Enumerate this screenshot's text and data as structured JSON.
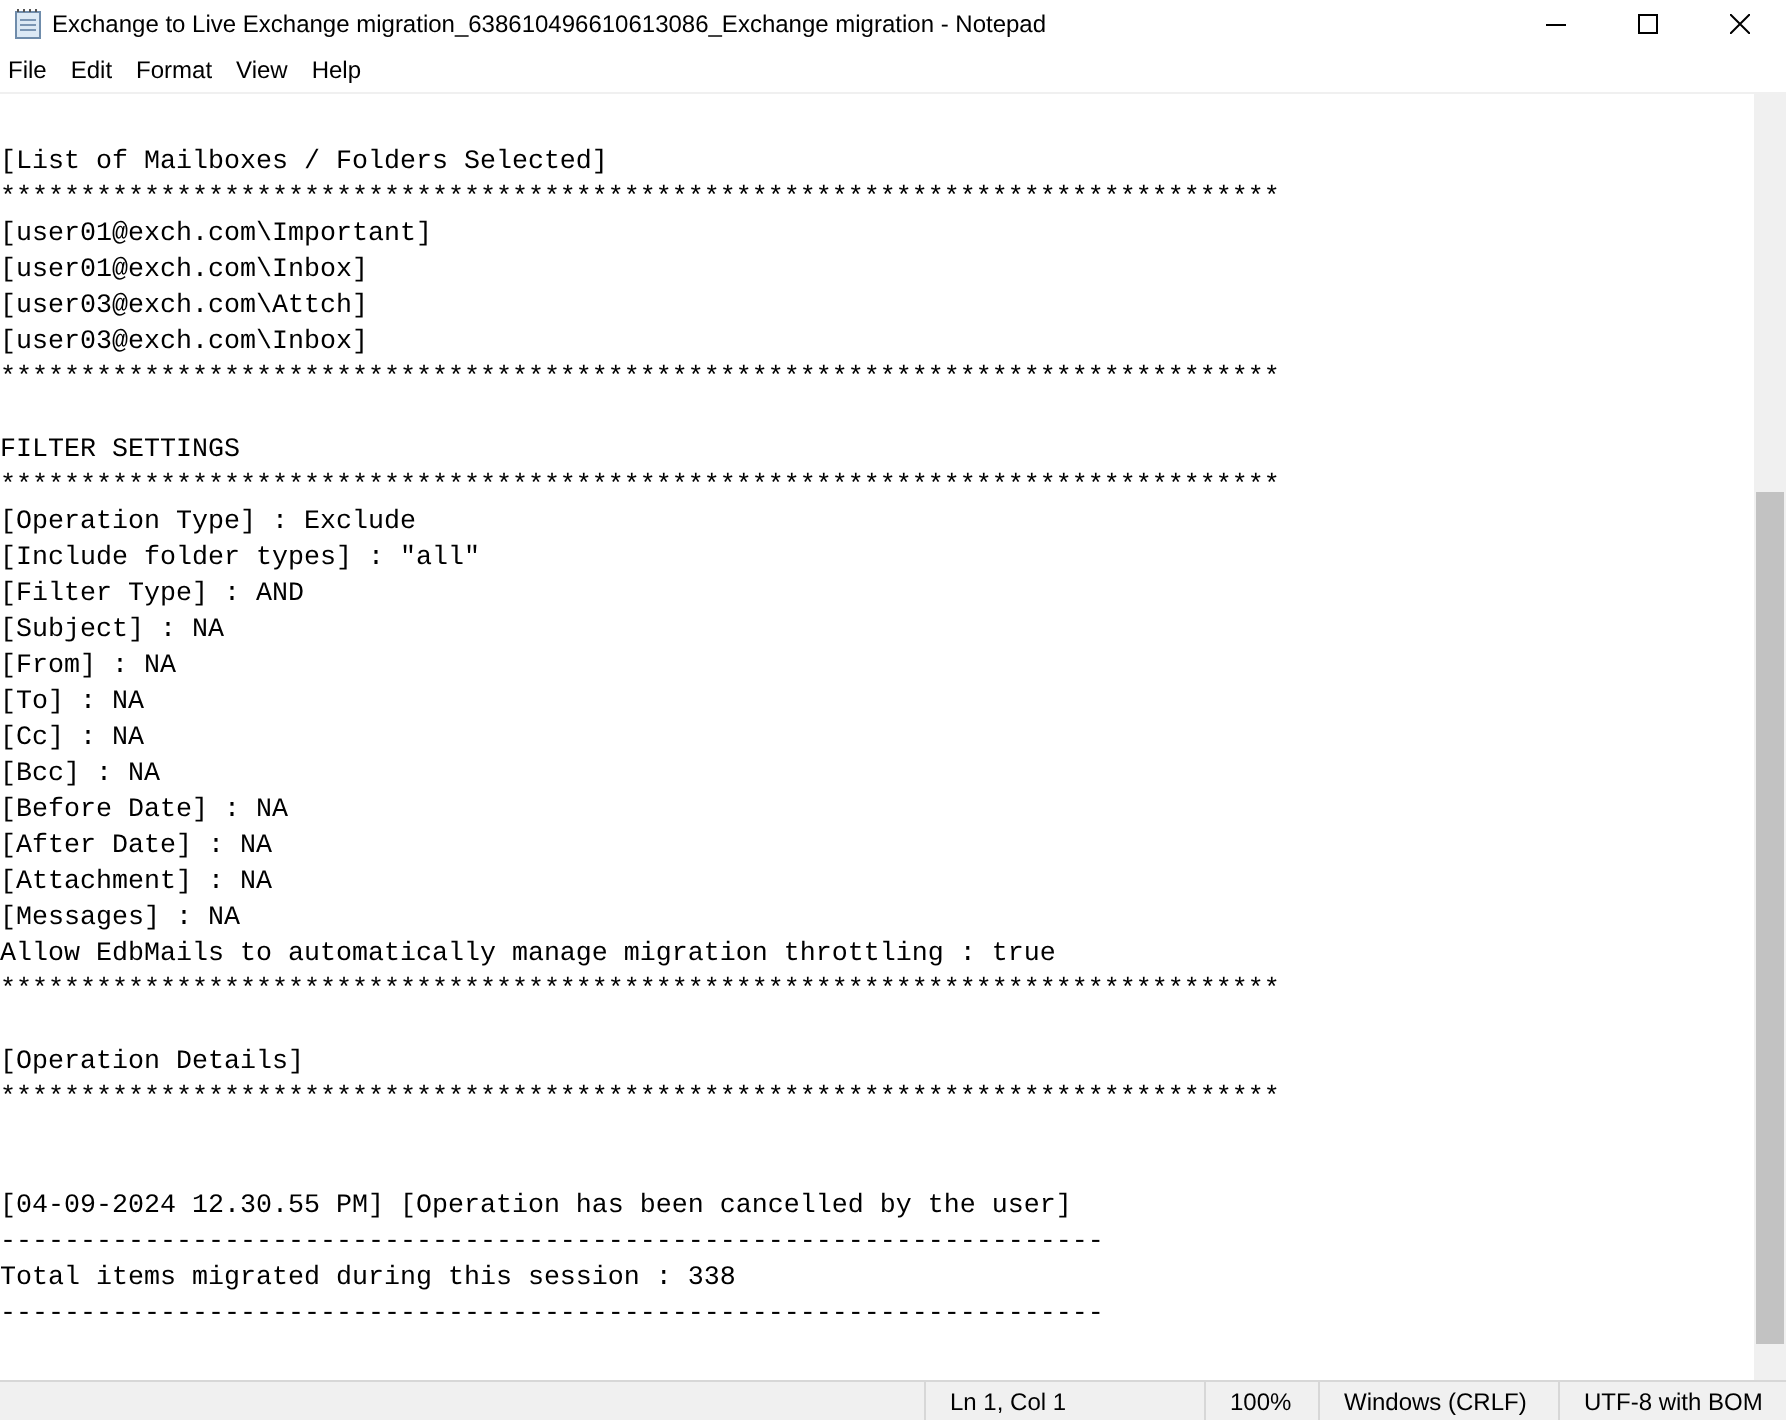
{
  "window": {
    "title": "Exchange to Live Exchange migration_638610496610613086_Exchange migration - Notepad"
  },
  "menu": [
    "File",
    "Edit",
    "Format",
    "View",
    "Help"
  ],
  "lines": [
    {
      "kind": "blank"
    },
    {
      "kind": "text",
      "text": "[List of Mailboxes / Folders Selected]"
    },
    {
      "kind": "text",
      "text": "********************************************************************************"
    },
    {
      "kind": "text",
      "text": "[user01@exch.com\\Important]"
    },
    {
      "kind": "text",
      "text": "[user01@exch.com\\Inbox]"
    },
    {
      "kind": "text",
      "text": "[user03@exch.com\\Attch]"
    },
    {
      "kind": "text",
      "text": "[user03@exch.com\\Inbox]"
    },
    {
      "kind": "text",
      "text": "********************************************************************************"
    },
    {
      "kind": "blank"
    },
    {
      "kind": "text",
      "text": "FILTER SETTINGS"
    },
    {
      "kind": "text",
      "text": "********************************************************************************"
    },
    {
      "kind": "text",
      "text": "[Operation Type] : Exclude"
    },
    {
      "kind": "text",
      "text": "[Include folder types] : \"all\""
    },
    {
      "kind": "text",
      "text": "[Filter Type] : AND"
    },
    {
      "kind": "text",
      "text": "[Subject] : NA"
    },
    {
      "kind": "text",
      "text": "[From] : NA"
    },
    {
      "kind": "text",
      "text": "[To] : NA"
    },
    {
      "kind": "text",
      "text": "[Cc] : NA"
    },
    {
      "kind": "text",
      "text": "[Bcc] : NA"
    },
    {
      "kind": "text",
      "text": "[Before Date] : NA"
    },
    {
      "kind": "text",
      "text": "[After Date] : NA"
    },
    {
      "kind": "text",
      "text": "[Attachment] : NA"
    },
    {
      "kind": "text",
      "text": "[Messages] : NA"
    },
    {
      "kind": "text",
      "text": "Allow EdbMails to automatically manage migration throttling : true"
    },
    {
      "kind": "text",
      "text": "********************************************************************************"
    },
    {
      "kind": "blank"
    },
    {
      "kind": "text",
      "text": "[Operation Details]"
    },
    {
      "kind": "text",
      "text": "********************************************************************************"
    },
    {
      "kind": "blank"
    },
    {
      "kind": "blank"
    },
    {
      "kind": "text",
      "text": "[04-09-2024 12.30.55 PM] [Operation has been cancelled by the user]"
    },
    {
      "kind": "text",
      "text": "---------------------------------------------------------------------"
    },
    {
      "kind": "text",
      "text": "Total items migrated during this session : 338"
    },
    {
      "kind": "text",
      "text": "---------------------------------------------------------------------"
    }
  ],
  "status_bar": [
    "Ln 1, Col 1",
    "100%",
    "Windows (CRLF)",
    "UTF-8 with BOM"
  ]
}
